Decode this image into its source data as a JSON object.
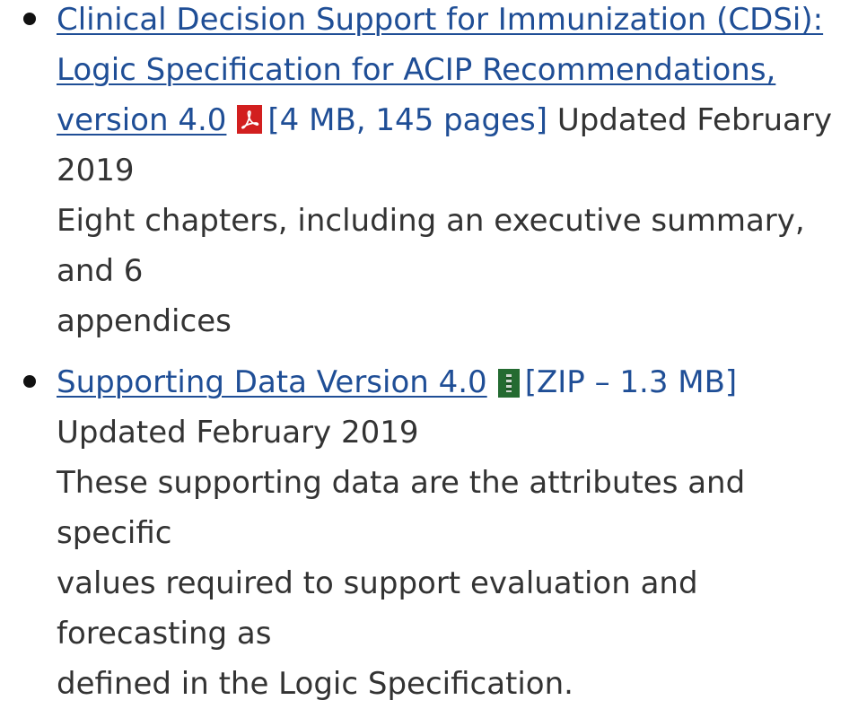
{
  "items": [
    {
      "link_text_line1": "Clinical Decision Support for Immunization (CDSi):",
      "link_text_line2": "Logic Specification for ACIP Recommendations,",
      "link_text_line3": "version 4.0",
      "file_icon": "pdf-icon",
      "file_info": "[4 MB, 145 pages]",
      "updated_part1": "Updated February",
      "updated_part2": "2019",
      "description_line1": "Eight chapters, including an executive summary, and 6",
      "description_line2": "appendices"
    },
    {
      "link_text": "Supporting Data Version 4.0",
      "file_icon": "zip-icon",
      "file_info": "[ZIP – 1.3 MB]",
      "updated": "Updated February 2019",
      "description_line1": "These supporting data are the attributes and specific",
      "description_line2": "values required to support evaluation and forecasting as",
      "description_line3": "defined in the Logic Specification."
    }
  ],
  "colors": {
    "link": "#1f4e96",
    "text": "#333333",
    "pdf_icon": "#d21f1f",
    "zip_icon": "#246b31"
  }
}
